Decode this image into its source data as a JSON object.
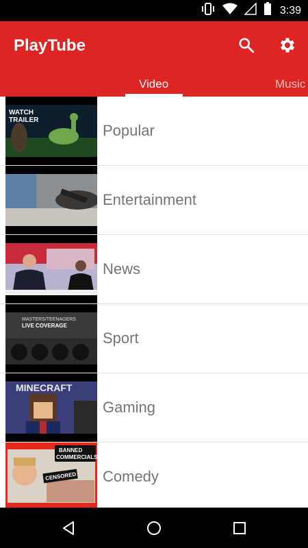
{
  "status_bar": {
    "time": "3:39",
    "icons": [
      "vibrate-icon",
      "wifi-icon",
      "signal-icon",
      "battery-icon"
    ]
  },
  "app_bar": {
    "title": "PlayTube",
    "actions": [
      "search-icon",
      "gear-icon"
    ],
    "color": "#df2424"
  },
  "tabs": [
    {
      "label": "Video",
      "selected": true
    },
    {
      "label": "Music",
      "selected": false
    }
  ],
  "categories": [
    {
      "label": "Popular",
      "thumb_text": [
        "WATCH",
        "TRAILER"
      ]
    },
    {
      "label": "Entertainment"
    },
    {
      "label": "News"
    },
    {
      "label": "Sport",
      "thumb_text": [
        "MASTERS/TEENAGERS",
        "LIVE COVERAGE"
      ]
    },
    {
      "label": "Gaming",
      "thumb_text": [
        "MINECRAFT"
      ]
    },
    {
      "label": "Comedy",
      "thumb_text": [
        "BANNED",
        "COMMERCIALS!",
        "CENSORED"
      ]
    }
  ],
  "nav_bar": {
    "buttons": [
      "back-icon",
      "home-icon",
      "recent-apps-icon"
    ]
  }
}
